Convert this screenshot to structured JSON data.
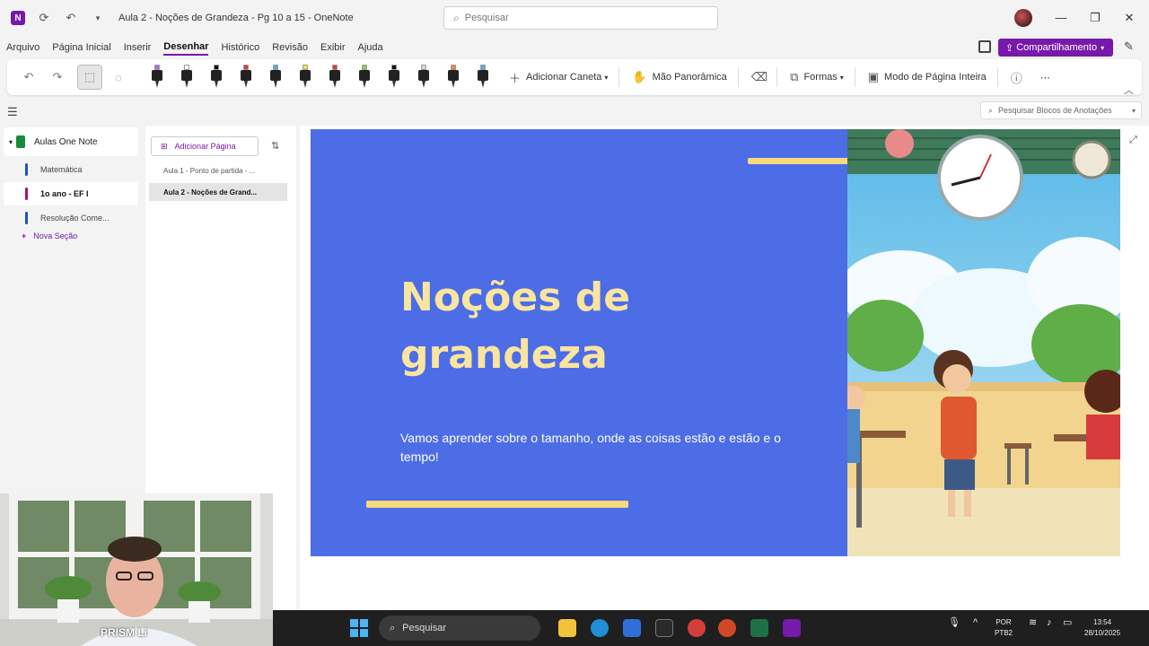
{
  "titlebar": {
    "document_title": "Aula 2 - Noções de Grandeza - Pg 10 a 15  -  OneNote",
    "search_placeholder": "Pesquisar",
    "minimize": "—",
    "maximize": "❐",
    "close": "✕"
  },
  "menu": {
    "items": [
      "Arquivo",
      "Página Inicial",
      "Inserir",
      "Desenhar",
      "Histórico",
      "Revisão",
      "Exibir",
      "Ajuda"
    ],
    "active": "Desenhar",
    "share_label": "Compartilhamento"
  },
  "ribbon": {
    "pens": [
      {
        "tip": "#b06be0"
      },
      {
        "tip": "#ffffff"
      },
      {
        "tip": "#111111"
      },
      {
        "tip": "#e03a3a"
      },
      {
        "tip": "#3fb6e8"
      },
      {
        "tip": "#f5e642"
      },
      {
        "tip": "#e03a3a"
      },
      {
        "tip": "#7ed957"
      },
      {
        "tip": "#111111"
      },
      {
        "tip": "#d9d9d9"
      },
      {
        "tip": "#f0882a"
      },
      {
        "tip": "#3fb6e8"
      }
    ],
    "add_pen_label": "Adicionar Caneta",
    "pan_label": "Mão Panorâmica",
    "shapes_label": "Formas",
    "fullpage_label": "Modo de Página Inteira",
    "more_label": "⋯"
  },
  "search_notes_placeholder": "Pesquisar Blocos de Anotações",
  "sections": {
    "notebook": "Aulas One Note",
    "items": [
      {
        "label": "Matemática",
        "color": "#1b56b8",
        "active": false
      },
      {
        "label": "1o ano - EF I",
        "color": "#a4166e",
        "active": true
      },
      {
        "label": "Resolução Come...",
        "color": "#1b56b8",
        "active": false
      }
    ],
    "new_section": "Nova Seção"
  },
  "pages": {
    "add_page": "Adicionar Página",
    "items": [
      {
        "label": "Aula 1 - Ponto de partida - ...",
        "active": false
      },
      {
        "label": "Aula 2 - Noções de Grand...",
        "active": true
      }
    ]
  },
  "slide": {
    "title": "Noções de grandeza",
    "subtitle": "Vamos aprender sobre o tamanho, onde as coisas estão e estão e o tempo!",
    "bg_color": "#4c6de6",
    "accent": "#f7d97e",
    "title_color": "#f9e4a0"
  },
  "webcam": {
    "label": "PRISM Li"
  },
  "taskbar": {
    "search_label": "Pesquisar",
    "lang_line1": "POR",
    "lang_line2": "PTB2",
    "time": "13:54",
    "date": "28/10/2025"
  }
}
